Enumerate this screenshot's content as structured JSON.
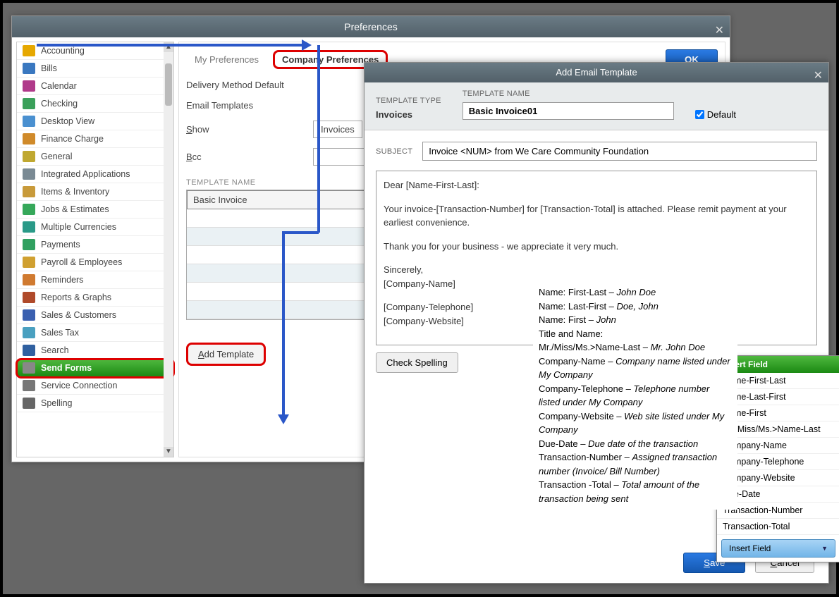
{
  "preferences": {
    "title": "Preferences",
    "tabs": {
      "my": "My Preferences",
      "company": "Company Preferences"
    },
    "ok": "OK",
    "labels": {
      "delivery": "Delivery Method Default",
      "email_templates": "Email Templates",
      "show": "Show",
      "bcc": "Bcc",
      "template_name_header": "TEMPLATE NAME"
    },
    "show_value": "Invoices",
    "template_list": [
      "Basic Invoice",
      "",
      "",
      "",
      "",
      "",
      ""
    ],
    "add_template": "Add Template"
  },
  "sidebar": {
    "items": [
      "Accounting",
      "Bills",
      "Calendar",
      "Checking",
      "Desktop View",
      "Finance Charge",
      "General",
      "Integrated Applications",
      "Items & Inventory",
      "Jobs & Estimates",
      "Multiple Currencies",
      "Payments",
      "Payroll & Employees",
      "Reminders",
      "Reports & Graphs",
      "Sales & Customers",
      "Sales Tax",
      "Search",
      "Send Forms",
      "Service Connection",
      "Spelling"
    ],
    "selected_index": 18
  },
  "email_dialog": {
    "title": "Add Email Template",
    "template_type_label": "TEMPLATE TYPE",
    "template_type": "Invoices",
    "template_name_label": "TEMPLATE NAME",
    "template_name": "Basic Invoice01",
    "default_label": "Default",
    "default_checked": true,
    "subject_label": "SUBJECT",
    "subject": "Invoice <NUM> from We Care Community Foundation",
    "body": {
      "greeting": "Dear [Name-First-Last]:",
      "p1": "Your invoice-[Transaction-Number] for [Transaction-Total] is attached. Please remit payment at your earliest convenience.",
      "p2": "Thank you for your business - we appreciate it very much.",
      "sig1": "Sincerely,",
      "sig2": "[Company-Name]",
      "sig3": "[Company-Telephone]",
      "sig4": "[Company-Website]"
    },
    "check_spelling": "Check Spelling",
    "save": "Save",
    "cancel": "Cancel"
  },
  "field_descriptions": [
    {
      "label": "Name: First-Last",
      "example": "John Doe"
    },
    {
      "label": "Name: Last-First",
      "example": "Doe, John"
    },
    {
      "label": "Name: First",
      "example": "John"
    },
    {
      "label": "Title and Name:",
      "example": ""
    },
    {
      "label": "Mr./Miss/Ms.>Name-Last",
      "example": "Mr. John Doe"
    },
    {
      "label": "Company-Name",
      "example": "Company name listed under My Company"
    },
    {
      "label": "Company-Telephone",
      "example": "Telephone number listed under My Company"
    },
    {
      "label": "Company-Website",
      "example": "Web site listed under My Company"
    },
    {
      "label": "Due-Date",
      "example": "Due date of the transaction"
    },
    {
      "label": "Transaction-Number",
      "example": "Assigned transaction number (Invoice/ Bill Number)"
    },
    {
      "label": "Transaction -Total",
      "example": "Total amount of the transaction being sent"
    }
  ],
  "insert_menu": {
    "header": "Insert Field",
    "items": [
      "Name-First-Last",
      "Name-Last-First",
      "Name-First",
      "Mr./Miss/Ms.>Name-Last",
      "Company-Name",
      "Company-Telephone",
      "Company-Website",
      "Due-Date",
      "Transaction-Number",
      "Transaction-Total"
    ],
    "button": "Insert Field"
  }
}
